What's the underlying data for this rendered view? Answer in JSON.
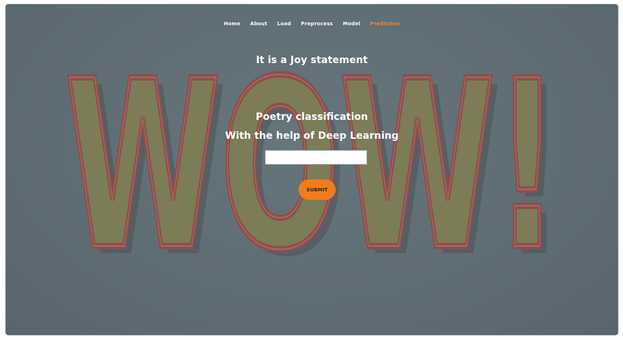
{
  "nav": {
    "items": [
      {
        "label": "Home",
        "active": false
      },
      {
        "label": "About",
        "active": false
      },
      {
        "label": "Load",
        "active": false
      },
      {
        "label": "Preprocess",
        "active": false
      },
      {
        "label": "Model",
        "active": false
      },
      {
        "label": "Prediction",
        "active": true
      }
    ]
  },
  "result": {
    "text": "It is a Joy statement"
  },
  "hero": {
    "title_line1": "Poetry classification",
    "title_line2": "With the help of Deep Learning"
  },
  "form": {
    "input_value": "",
    "input_placeholder": "",
    "submit_label": "SUBMIT"
  },
  "colors": {
    "accent": "#f07d1a",
    "background": "#5f6c74",
    "wow_fill": "#8c8448",
    "wow_outline": "#b0393a"
  },
  "background_art": {
    "wordmark": "WOW!"
  }
}
